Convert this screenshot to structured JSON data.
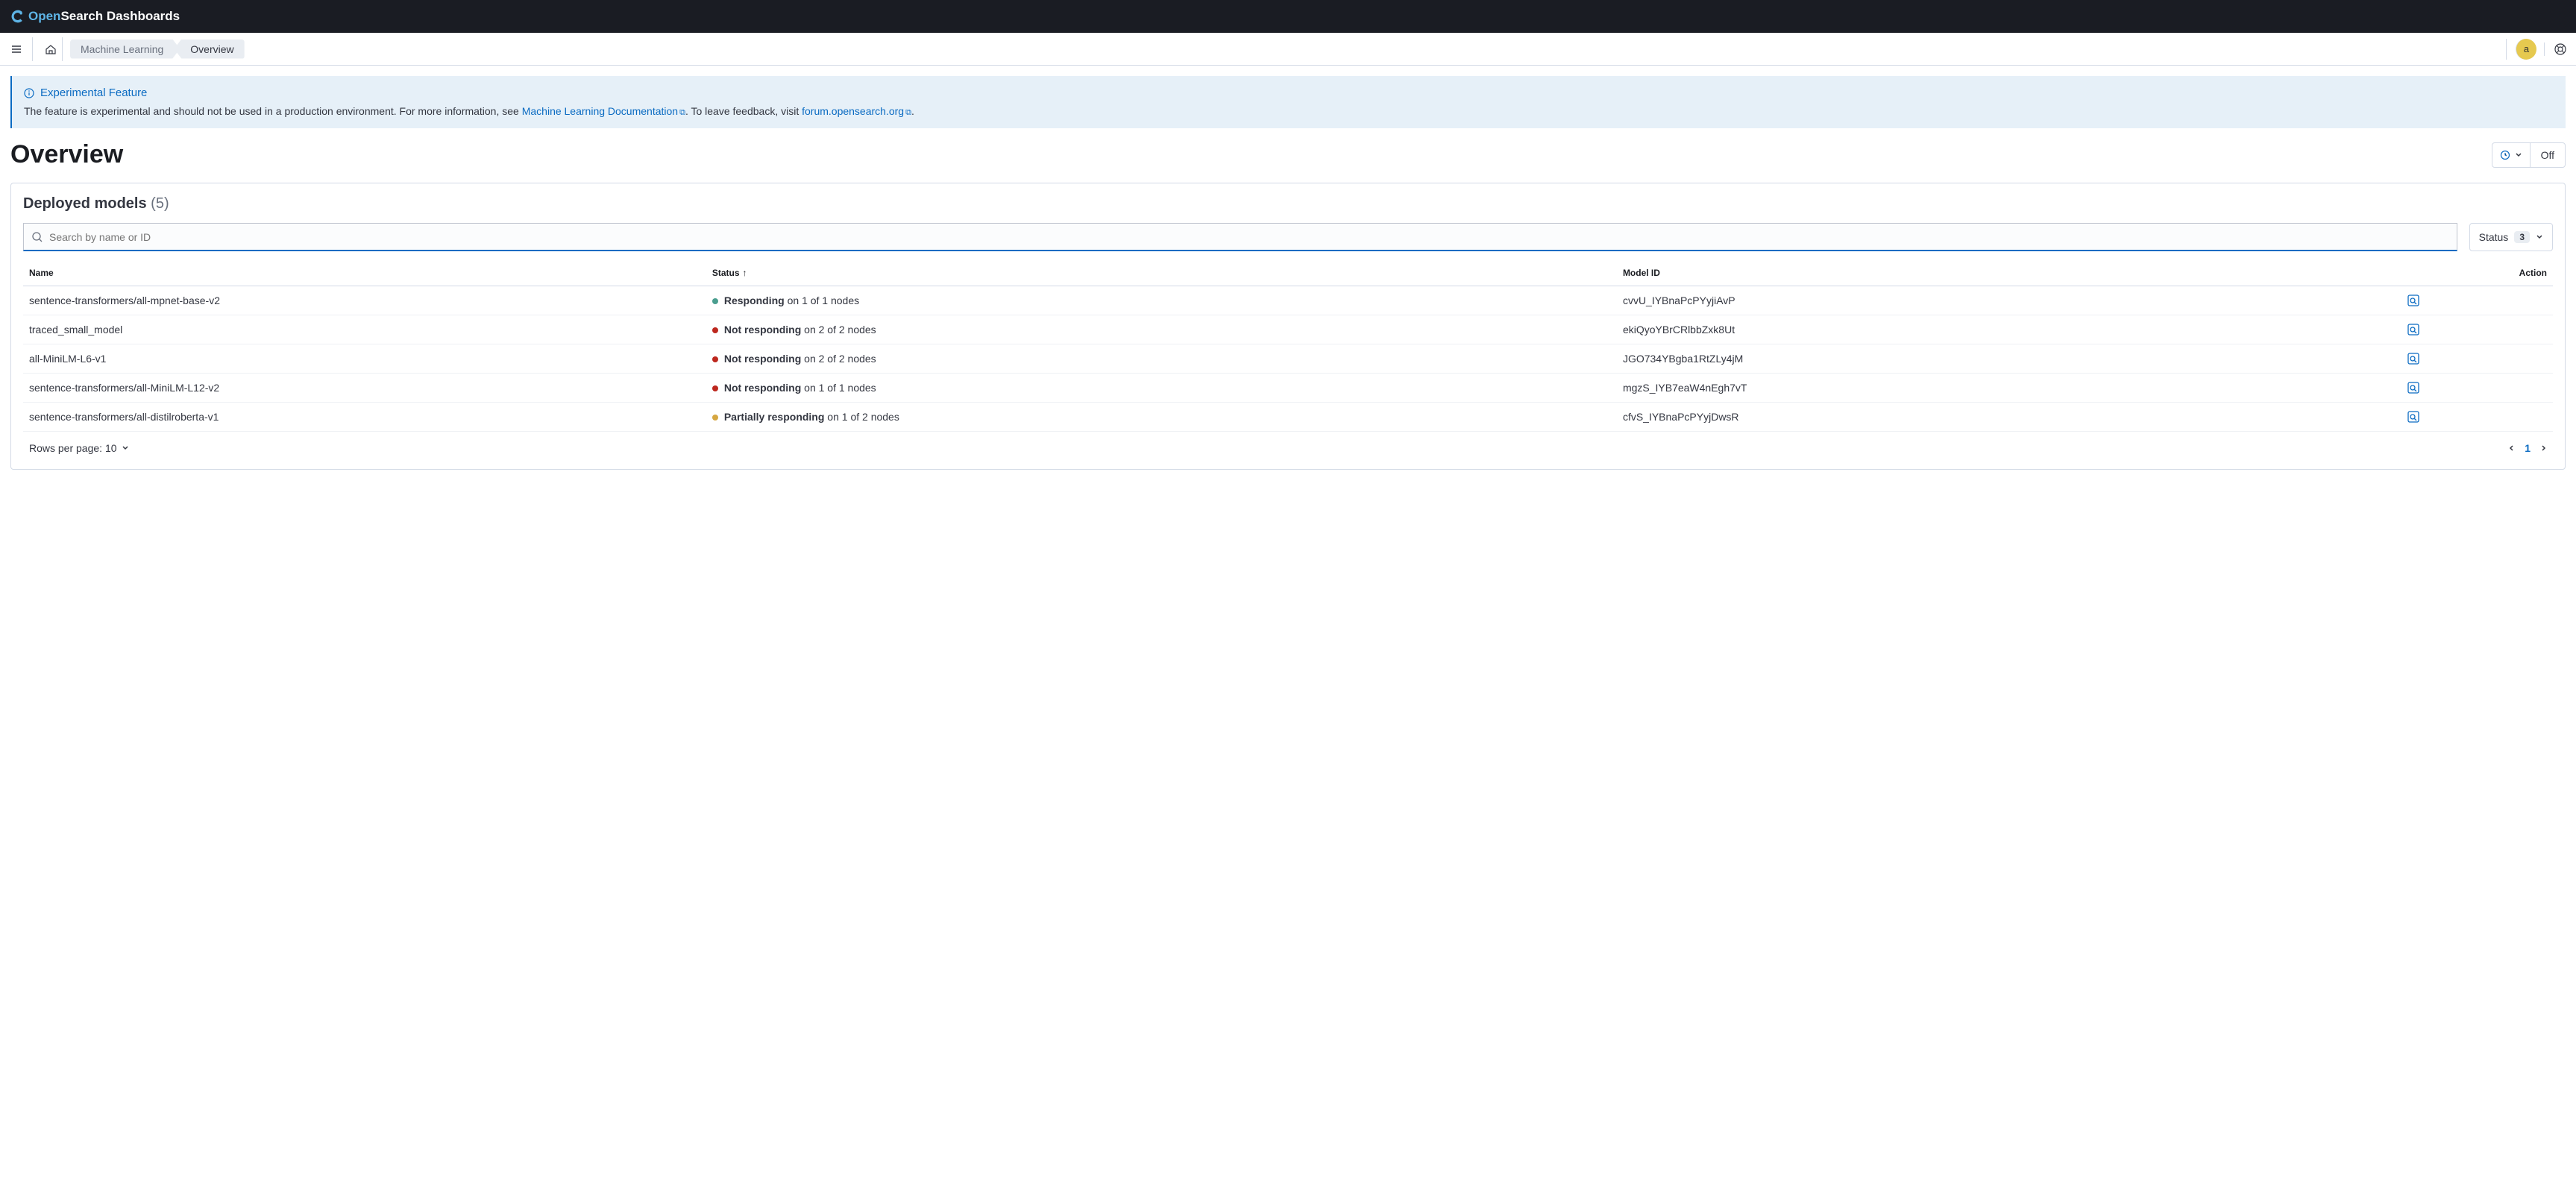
{
  "header": {
    "brand_open": "Open",
    "brand_rest": "Search Dashboards"
  },
  "subheader": {
    "breadcrumb1": "Machine Learning",
    "breadcrumb2": "Overview",
    "avatar_letter": "a"
  },
  "callout": {
    "title": "Experimental Feature",
    "body_pre": "The feature is experimental and should not be used in a production environment. For more information, see ",
    "link1": "Machine Learning Documentation",
    "body_mid": ". To leave feedback, visit ",
    "link2": "forum.opensearch.org",
    "body_post": "."
  },
  "page": {
    "title": "Overview",
    "refresh_state": "Off"
  },
  "panel": {
    "title": "Deployed models",
    "count": "(5)",
    "search_placeholder": "Search by name or ID",
    "status_label": "Status",
    "status_count": "3"
  },
  "columns": {
    "name": "Name",
    "status": "Status",
    "model_id": "Model ID",
    "action": "Action"
  },
  "rows": [
    {
      "name": "sentence-transformers/all-mpnet-base-v2",
      "status_label": "Responding",
      "status_detail": " on 1 of 1 nodes",
      "dot": "dot-green",
      "model_id": "cvvU_IYBnaPcPYyjiAvP"
    },
    {
      "name": "traced_small_model",
      "status_label": "Not responding",
      "status_detail": " on 2 of 2 nodes",
      "dot": "dot-red",
      "model_id": "ekiQyoYBrCRlbbZxk8Ut"
    },
    {
      "name": "all-MiniLM-L6-v1",
      "status_label": "Not responding",
      "status_detail": " on 2 of 2 nodes",
      "dot": "dot-red",
      "model_id": "JGO734YBgba1RtZLy4jM"
    },
    {
      "name": "sentence-transformers/all-MiniLM-L12-v2",
      "status_label": "Not responding",
      "status_detail": " on 1 of 1 nodes",
      "dot": "dot-red",
      "model_id": "mgzS_IYB7eaW4nEgh7vT"
    },
    {
      "name": "sentence-transformers/all-distilroberta-v1",
      "status_label": "Partially responding",
      "status_detail": " on 1 of 2 nodes",
      "dot": "dot-yellow",
      "model_id": "cfvS_IYBnaPcPYyjDwsR"
    }
  ],
  "footer": {
    "rows_label": "Rows per page: 10",
    "page": "1"
  }
}
